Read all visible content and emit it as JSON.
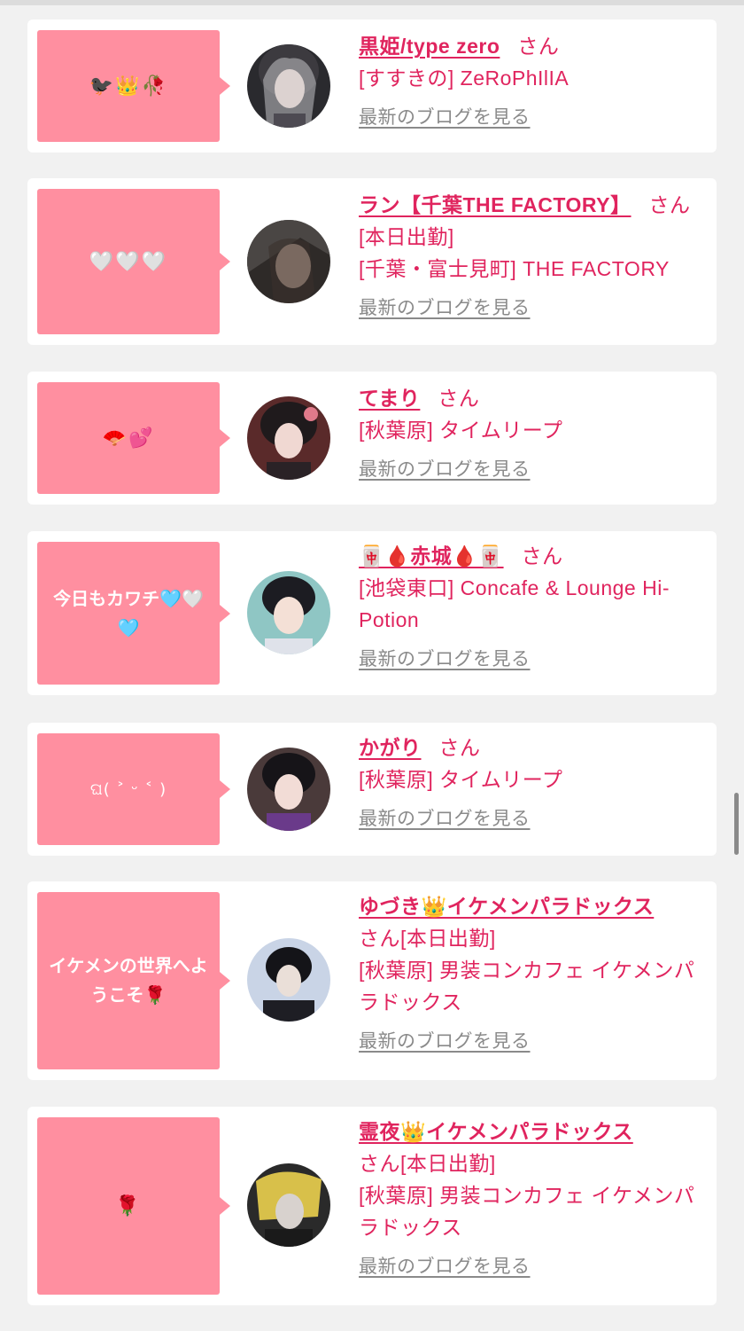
{
  "cards": [
    {
      "bubble": "🐦‍⬛👑🥀",
      "name": "黒姫/type zero",
      "suffix": "さん",
      "lines": [
        "[すすきの] ZeRoPhIlIA"
      ],
      "blog": "最新のブログを見る"
    },
    {
      "bubble": "🤍🤍🤍",
      "name": "ラン【千葉THE FACTORY】",
      "suffix": "さん",
      "lines": [
        "[本日出勤]",
        "[千葉・富士見町] THE FACTORY"
      ],
      "blog": "最新のブログを見る"
    },
    {
      "bubble": "🪭💕",
      "name": "てまり",
      "suffix": "さん",
      "lines": [
        "[秋葉原] タイムリープ"
      ],
      "blog": "最新のブログを見る"
    },
    {
      "bubble": "今日もカワチ🩵🤍🩵",
      "name": "🀄🩸赤城🩸🀄",
      "suffix": "さん",
      "lines": [
        "[池袋東口] Concafe & Lounge Hi-Potion"
      ],
      "blog": "最新のブログを見る"
    },
    {
      "bubble": "ଘ( ˃ ᵕ ˂ )",
      "name": "かがり",
      "suffix": "さん",
      "lines": [
        "[秋葉原] タイムリープ"
      ],
      "blog": "最新のブログを見る"
    },
    {
      "bubble": "イケメンの世界へようこそ🌹",
      "name": "ゆづき👑イケメンパラドックス",
      "suffix": "さん[本日出勤]",
      "lines": [
        "[秋葉原] 男装コンカフェ イケメンパラドックス"
      ],
      "blog": "最新のブログを見る"
    },
    {
      "bubble": "🌹",
      "name": "霊夜👑イケメンパラドックス",
      "suffix": "さん[本日出勤]",
      "lines": [
        "[秋葉原] 男装コンカフェ イケメンパラドックス"
      ],
      "blog": "最新のブログを見る"
    }
  ],
  "colors": {
    "accent": "#e0245e",
    "bubble": "#ff8fa0",
    "link_gray": "#8a8a8a",
    "background": "#f1f1f1"
  },
  "icons": [
    "avatar-image",
    "scrollbar-thumb"
  ]
}
